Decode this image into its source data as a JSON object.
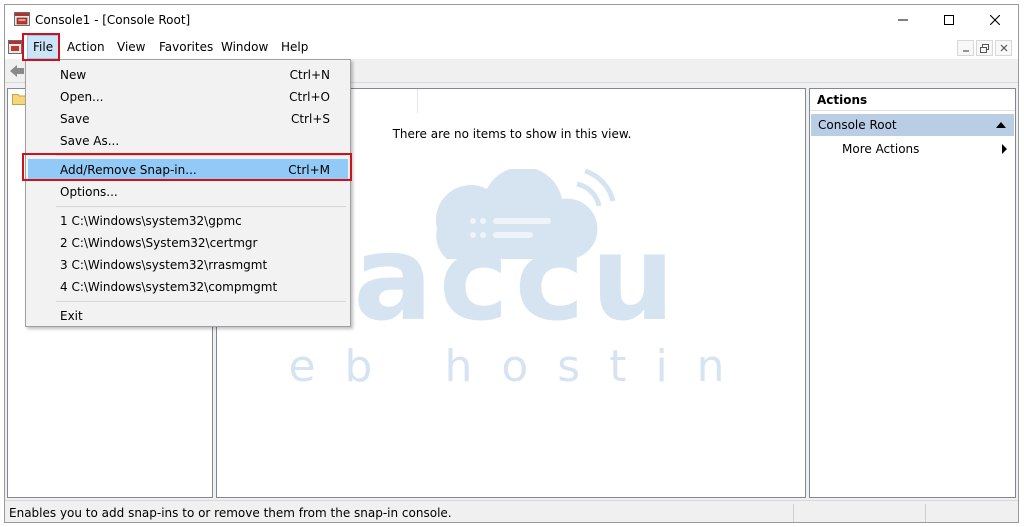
{
  "window": {
    "title": "Console1 - [Console Root]"
  },
  "menubar": {
    "items": [
      "File",
      "Action",
      "View",
      "Favorites",
      "Window",
      "Help"
    ]
  },
  "file_menu": {
    "items": [
      {
        "label": "New",
        "shortcut": "Ctrl+N"
      },
      {
        "label": "Open...",
        "shortcut": "Ctrl+O"
      },
      {
        "label": "Save",
        "shortcut": "Ctrl+S"
      },
      {
        "label": "Save As...",
        "shortcut": ""
      },
      {
        "label": "Add/Remove Snap-in...",
        "shortcut": "Ctrl+M"
      },
      {
        "label": "Options...",
        "shortcut": ""
      },
      {
        "label": "1 C:\\Windows\\system32\\gpmc",
        "shortcut": ""
      },
      {
        "label": "2 C:\\Windows\\System32\\certmgr",
        "shortcut": ""
      },
      {
        "label": "3 C:\\Windows\\system32\\rrasmgmt",
        "shortcut": ""
      },
      {
        "label": "4 C:\\Windows\\system32\\compmgmt",
        "shortcut": ""
      },
      {
        "label": "Exit",
        "shortcut": ""
      }
    ],
    "selected_item": "Add/Remove Snap-in..."
  },
  "center": {
    "empty_message": "There are no items to show in this view."
  },
  "actions": {
    "header": "Actions",
    "section": "Console Root",
    "items": [
      "More Actions"
    ]
  },
  "statusbar": {
    "text": "Enables you to add snap-ins to or remove them from the snap-in console."
  },
  "watermark": {
    "brand": "accu",
    "tagline": "web hosting"
  },
  "colors": {
    "highlight_box": "#d0101a",
    "menu_selected": "#91c9f7",
    "actions_section": "#b9cde5",
    "watermark": "#4a8ac6"
  }
}
